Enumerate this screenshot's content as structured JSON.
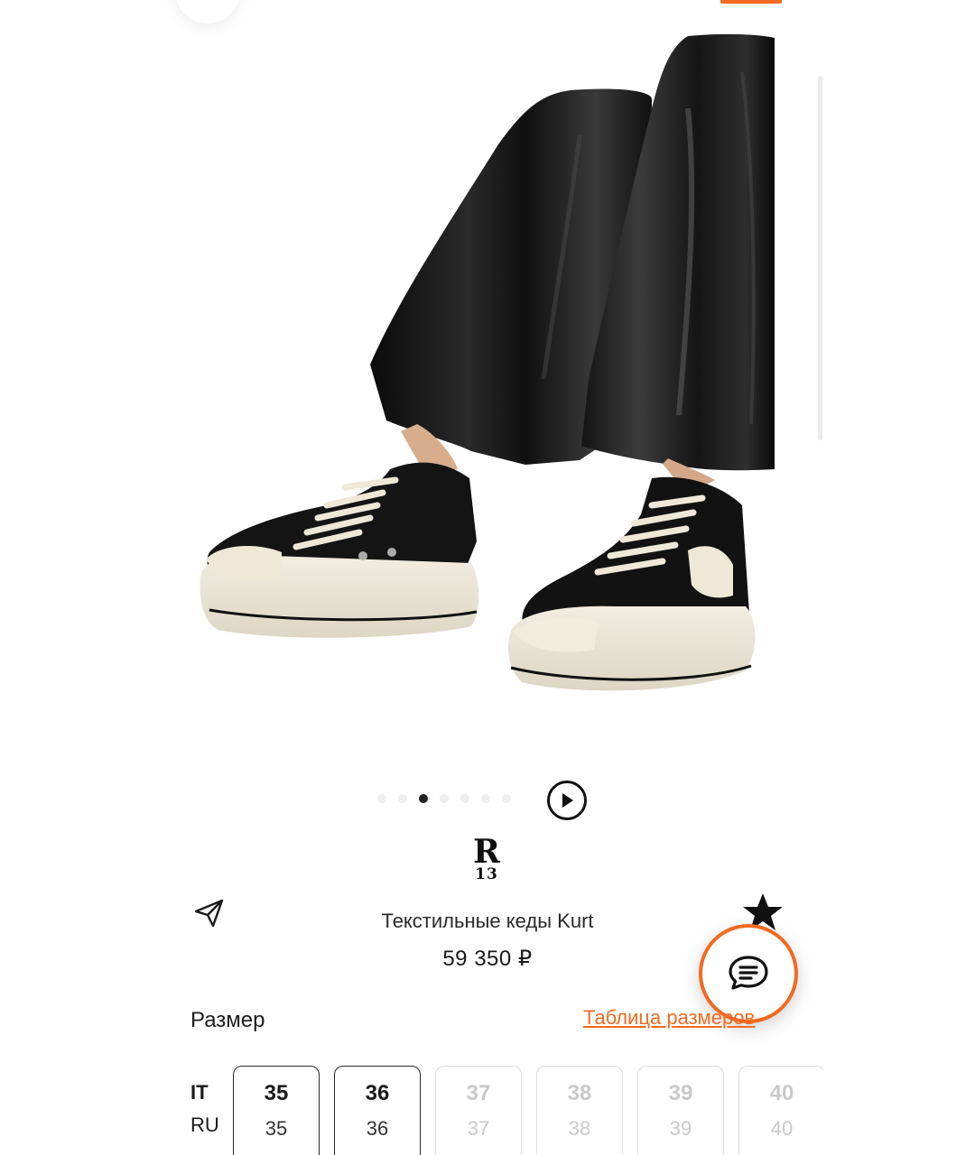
{
  "product": {
    "brand_logo_top": "R",
    "brand_logo_bottom": "13",
    "title": "Текстильные кеды Kurt",
    "price": "59 350 ₽"
  },
  "gallery": {
    "slide_count": 7,
    "active_slide": 3
  },
  "size_section": {
    "label": "Размер",
    "size_table_link": "Таблица размеров",
    "system_primary": "IT",
    "system_secondary": "RU",
    "sizes": [
      {
        "it": "35",
        "ru": "35",
        "available": true
      },
      {
        "it": "36",
        "ru": "36",
        "available": true
      },
      {
        "it": "37",
        "ru": "37",
        "available": false
      },
      {
        "it": "38",
        "ru": "38",
        "available": false
      },
      {
        "it": "39",
        "ru": "39",
        "available": false
      },
      {
        "it": "40",
        "ru": "40",
        "available": false
      }
    ]
  },
  "icons": {
    "share": "paper-plane-icon",
    "favorite": "star-icon",
    "chat": "chat-bubble-icon",
    "play": "play-icon"
  },
  "colors": {
    "accent": "#f26a21",
    "text": "#222222",
    "disabled": "#c9c9c9"
  }
}
